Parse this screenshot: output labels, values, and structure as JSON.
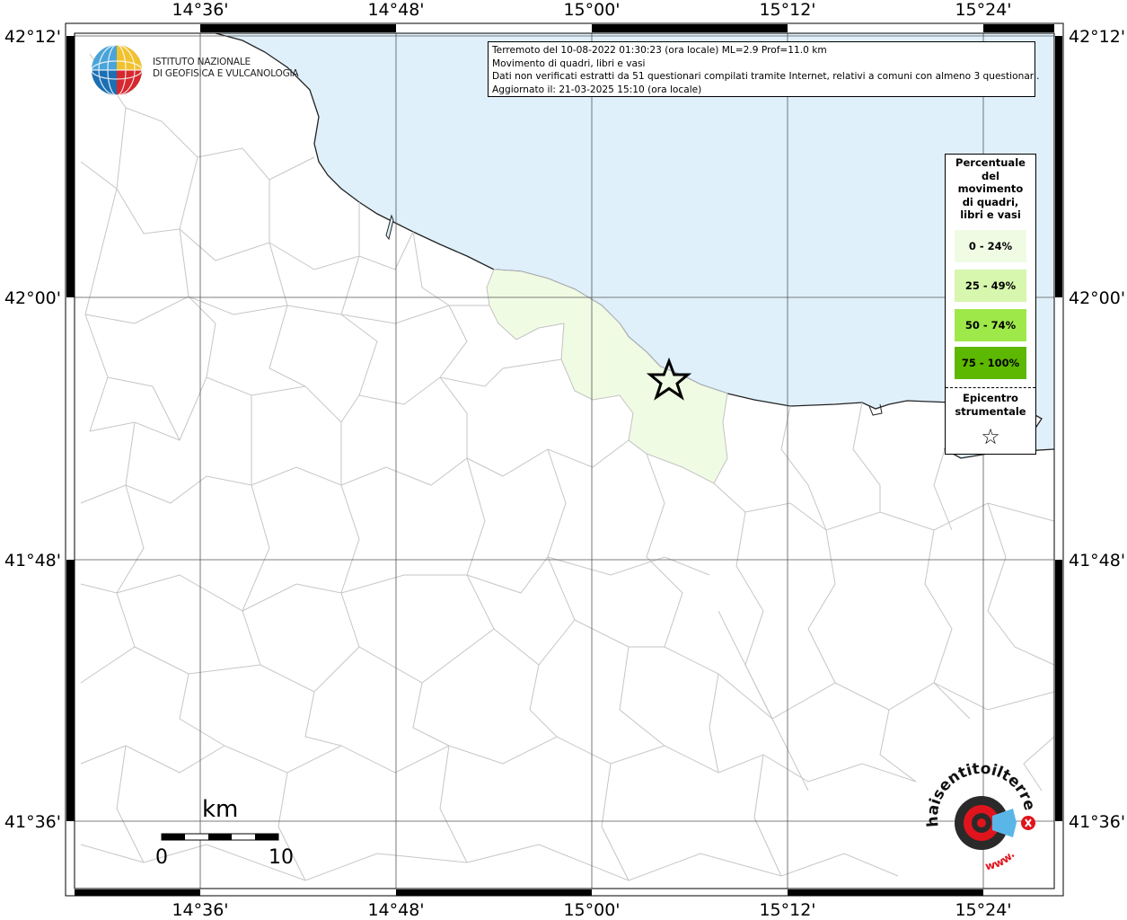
{
  "map": {
    "lon_ticks": [
      "14°36'",
      "14°48'",
      "15°00'",
      "15°12'",
      "15°24'"
    ],
    "lat_ticks": [
      "42°12'",
      "42°00'",
      "41°48'",
      "41°36'"
    ],
    "colors": {
      "sea": "#dff0fb",
      "land": "#ffffff",
      "class_0_24": "#f0fbe4",
      "border": "#c3c3c3",
      "coast": "#222222"
    }
  },
  "info": {
    "line1": "Terremoto del 10-08-2022 01:30:23 (ora locale) ML=2.9 Prof=11.0 km",
    "line2": "Movimento di quadri, libri e vasi",
    "line3": "Dati non verificati estratti da 51 questionari compilati tramite Internet, relativi a comuni con almeno 3 questionari.",
    "line4": "Aggiornato il: 21-03-2025 15:10 (ora locale)"
  },
  "logo": {
    "line1": "ISTITUTO NAZIONALE",
    "line2": "DI GEOFISICA E VULCANOLOGIA"
  },
  "legend": {
    "title": [
      "Percentuale",
      "del",
      "movimento",
      "di quadri,",
      "libri e vasi"
    ],
    "classes": [
      {
        "label": "0 - 24%",
        "color": "#f0fbe4"
      },
      {
        "label": "25 - 49%",
        "color": "#d7f6ae"
      },
      {
        "label": "50 - 74%",
        "color": "#9ee84a"
      },
      {
        "label": "75 - 100%",
        "color": "#5cb800"
      }
    ],
    "epicentre": [
      "Epicentro",
      "strumentale"
    ],
    "epicentre_symbol": "☆"
  },
  "scale": {
    "unit": "km",
    "min": "0",
    "max": "10"
  },
  "watermark": {
    "text": "haisentitoilterremoto.it",
    "prefix": "www."
  }
}
